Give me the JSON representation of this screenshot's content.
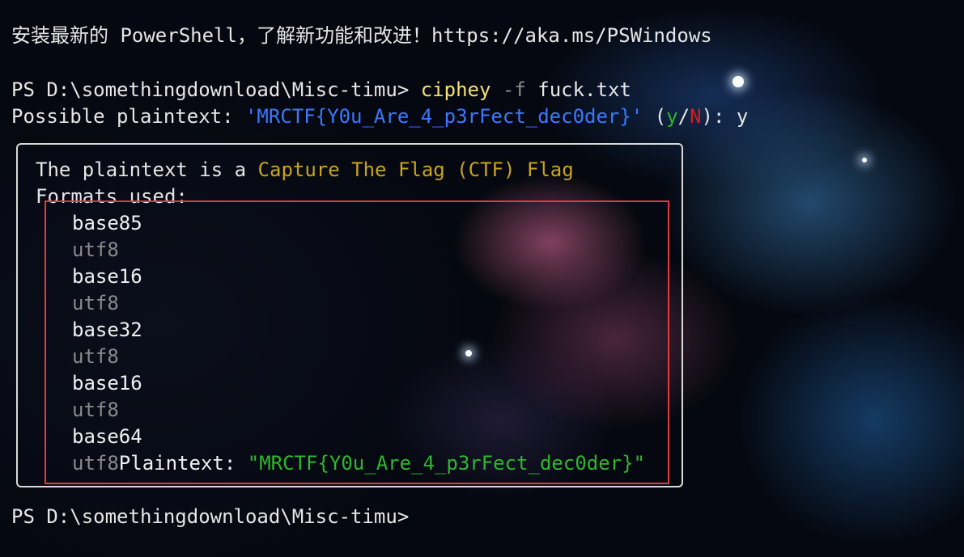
{
  "terminal": {
    "banner": "安装最新的 PowerShell，了解新功能和改进！https://aka.ms/PSWindows",
    "prompt": "PS D:\\somethingdownload\\Misc-timu>",
    "command": {
      "program": "ciphey",
      "flag": "-f",
      "file": "fuck.txt"
    },
    "possible_line": {
      "label": "Possible plaintext: ",
      "value": "'MRCTF{Y0u_Are_4_p3rFect_dec0der}'",
      "open_paren": " (",
      "yes": "y",
      "slash": "/",
      "no": "N",
      "close": "): ",
      "answer": "y"
    },
    "result_panel": {
      "intro": "The plaintext is a ",
      "type_label": "Capture The Flag (CTF) Flag",
      "formats_label": "Formats used:",
      "formats": [
        "base85",
        "utf8",
        "base16",
        "utf8",
        "base32",
        "utf8",
        "base16",
        "utf8",
        "base64",
        "utf8"
      ],
      "plaintext_label": "Plaintext: ",
      "plaintext_value": "\"MRCTF{Y0u_Are_4_p3rFect_dec0der}\""
    },
    "final_prompt": "PS D:\\somethingdownload\\Misc-timu>"
  },
  "colors": {
    "command": "#f3e07a",
    "string": "#3b78ff",
    "yes": "#2fb62f",
    "no": "#d11f1f",
    "flag_type": "#c9a31a",
    "secondary_format": "#8a8a8a",
    "plaintext_value": "#2fb62f",
    "highlight_box": "#e03c3c"
  }
}
